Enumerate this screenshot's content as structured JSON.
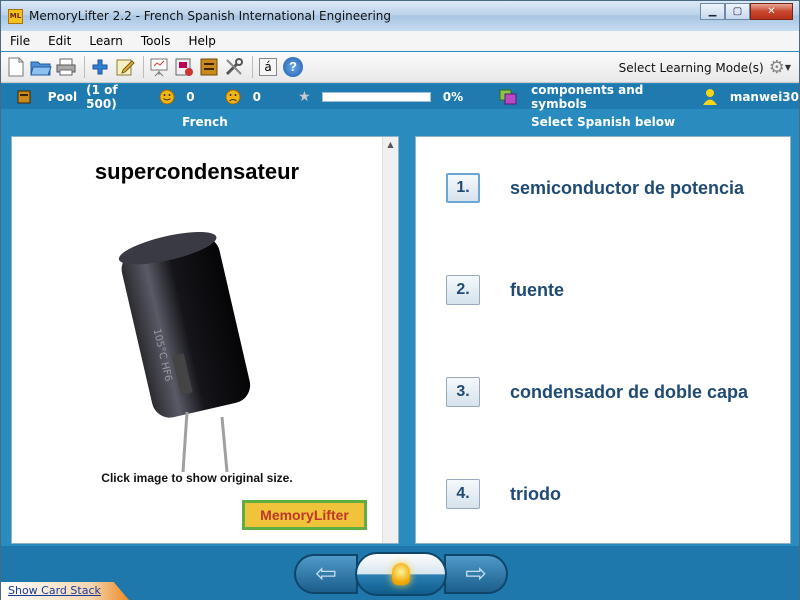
{
  "window": {
    "title": "MemoryLifter 2.2 - French Spanish International Engineering",
    "app_icon_text": "ML",
    "minimize": "▁",
    "maximize": "▢",
    "close": "✕"
  },
  "menu": [
    "File",
    "Edit",
    "Learn",
    "Tools",
    "Help"
  ],
  "toolbar": {
    "icons": [
      "new-icon",
      "open-icon",
      "print-icon",
      "add-icon",
      "edit-icon",
      "presenter-icon",
      "card-icon",
      "box-icon",
      "tools-icon",
      "accent-icon",
      "help-icon"
    ],
    "accent_char": "á",
    "help_char": "?",
    "mode_label": "Select Learning Mode(s)"
  },
  "status": {
    "pool_label": "Pool",
    "pool_count": "(1 of 500)",
    "correct_count": "0",
    "wrong_count": "0",
    "progress_percent": "0%",
    "progress_value": 0,
    "chapter": "components and symbols",
    "user": "manwei30"
  },
  "question": {
    "header": "French",
    "word": "supercondensateur",
    "image_hint": "Click image to show original size.",
    "logo_text": "MemoryLifter"
  },
  "answers": {
    "header": "Select Spanish below",
    "items": [
      {
        "number": "1.",
        "text": "semiconductor de potencia"
      },
      {
        "number": "2.",
        "text": "fuente"
      },
      {
        "number": "3.",
        "text": "condensador de doble capa"
      },
      {
        "number": "4.",
        "text": "triodo"
      }
    ]
  },
  "bottom": {
    "card_stack_link": "Show Card Stack"
  },
  "colors": {
    "frame": "#2a8cbe",
    "answer_text": "#1f4a74",
    "status_bar": "#1f7ab0"
  }
}
